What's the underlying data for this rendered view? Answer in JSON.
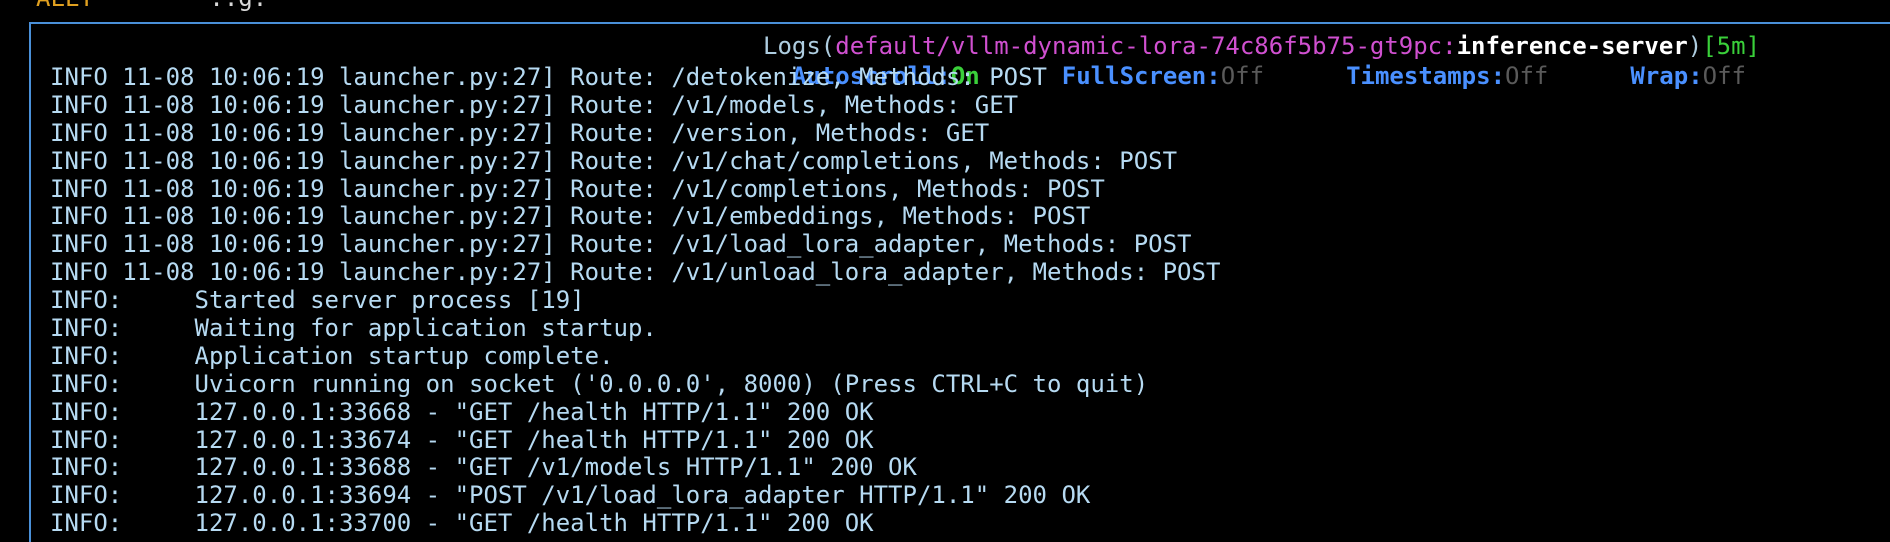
{
  "top_fragment": {
    "left": "ALLT",
    "right": "..g."
  },
  "title": {
    "label": "Logs",
    "namespace": "default",
    "separator": "/",
    "pod": "vllm-dynamic-lora-74c86f5b75-gt9pc",
    "colon": ":",
    "container": "inference-server",
    "age": "[5m]"
  },
  "toggles": [
    {
      "key": "Autoscroll:",
      "value": "On",
      "state": "on"
    },
    {
      "key": "FullScreen:",
      "value": "Off",
      "state": "off"
    },
    {
      "key": "Timestamps:",
      "value": "Off",
      "state": "off"
    },
    {
      "key": "Wrap:",
      "value": "Off",
      "state": "off"
    }
  ],
  "log_lines": [
    "INFO 11-08 10:06:19 launcher.py:27] Route: /detokenize, Methods: POST",
    "INFO 11-08 10:06:19 launcher.py:27] Route: /v1/models, Methods: GET",
    "INFO 11-08 10:06:19 launcher.py:27] Route: /version, Methods: GET",
    "INFO 11-08 10:06:19 launcher.py:27] Route: /v1/chat/completions, Methods: POST",
    "INFO 11-08 10:06:19 launcher.py:27] Route: /v1/completions, Methods: POST",
    "INFO 11-08 10:06:19 launcher.py:27] Route: /v1/embeddings, Methods: POST",
    "INFO 11-08 10:06:19 launcher.py:27] Route: /v1/load_lora_adapter, Methods: POST",
    "INFO 11-08 10:06:19 launcher.py:27] Route: /v1/unload_lora_adapter, Methods: POST",
    "INFO:     Started server process [19]",
    "INFO:     Waiting for application startup.",
    "INFO:     Application startup complete.",
    "INFO:     Uvicorn running on socket ('0.0.0.0', 8000) (Press CTRL+C to quit)",
    "INFO:     127.0.0.1:33668 - \"GET /health HTTP/1.1\" 200 OK",
    "INFO:     127.0.0.1:33674 - \"GET /health HTTP/1.1\" 200 OK",
    "INFO:     127.0.0.1:33688 - \"GET /v1/models HTTP/1.1\" 200 OK",
    "INFO:     127.0.0.1:33694 - \"POST /v1/load_lora_adapter HTTP/1.1\" 200 OK",
    "INFO:     127.0.0.1:33700 - \"GET /health HTTP/1.1\" 200 OK"
  ],
  "colors": {
    "background": "#000000",
    "border": "#4a90d9",
    "log_text": "#b6daf2",
    "namespace_pod": "#d050d0",
    "container": "#ffffff",
    "age": "#3ad03a",
    "toggle_key": "#4a90ff",
    "toggle_on": "#3ad03a",
    "toggle_off": "#5a5a5a"
  }
}
